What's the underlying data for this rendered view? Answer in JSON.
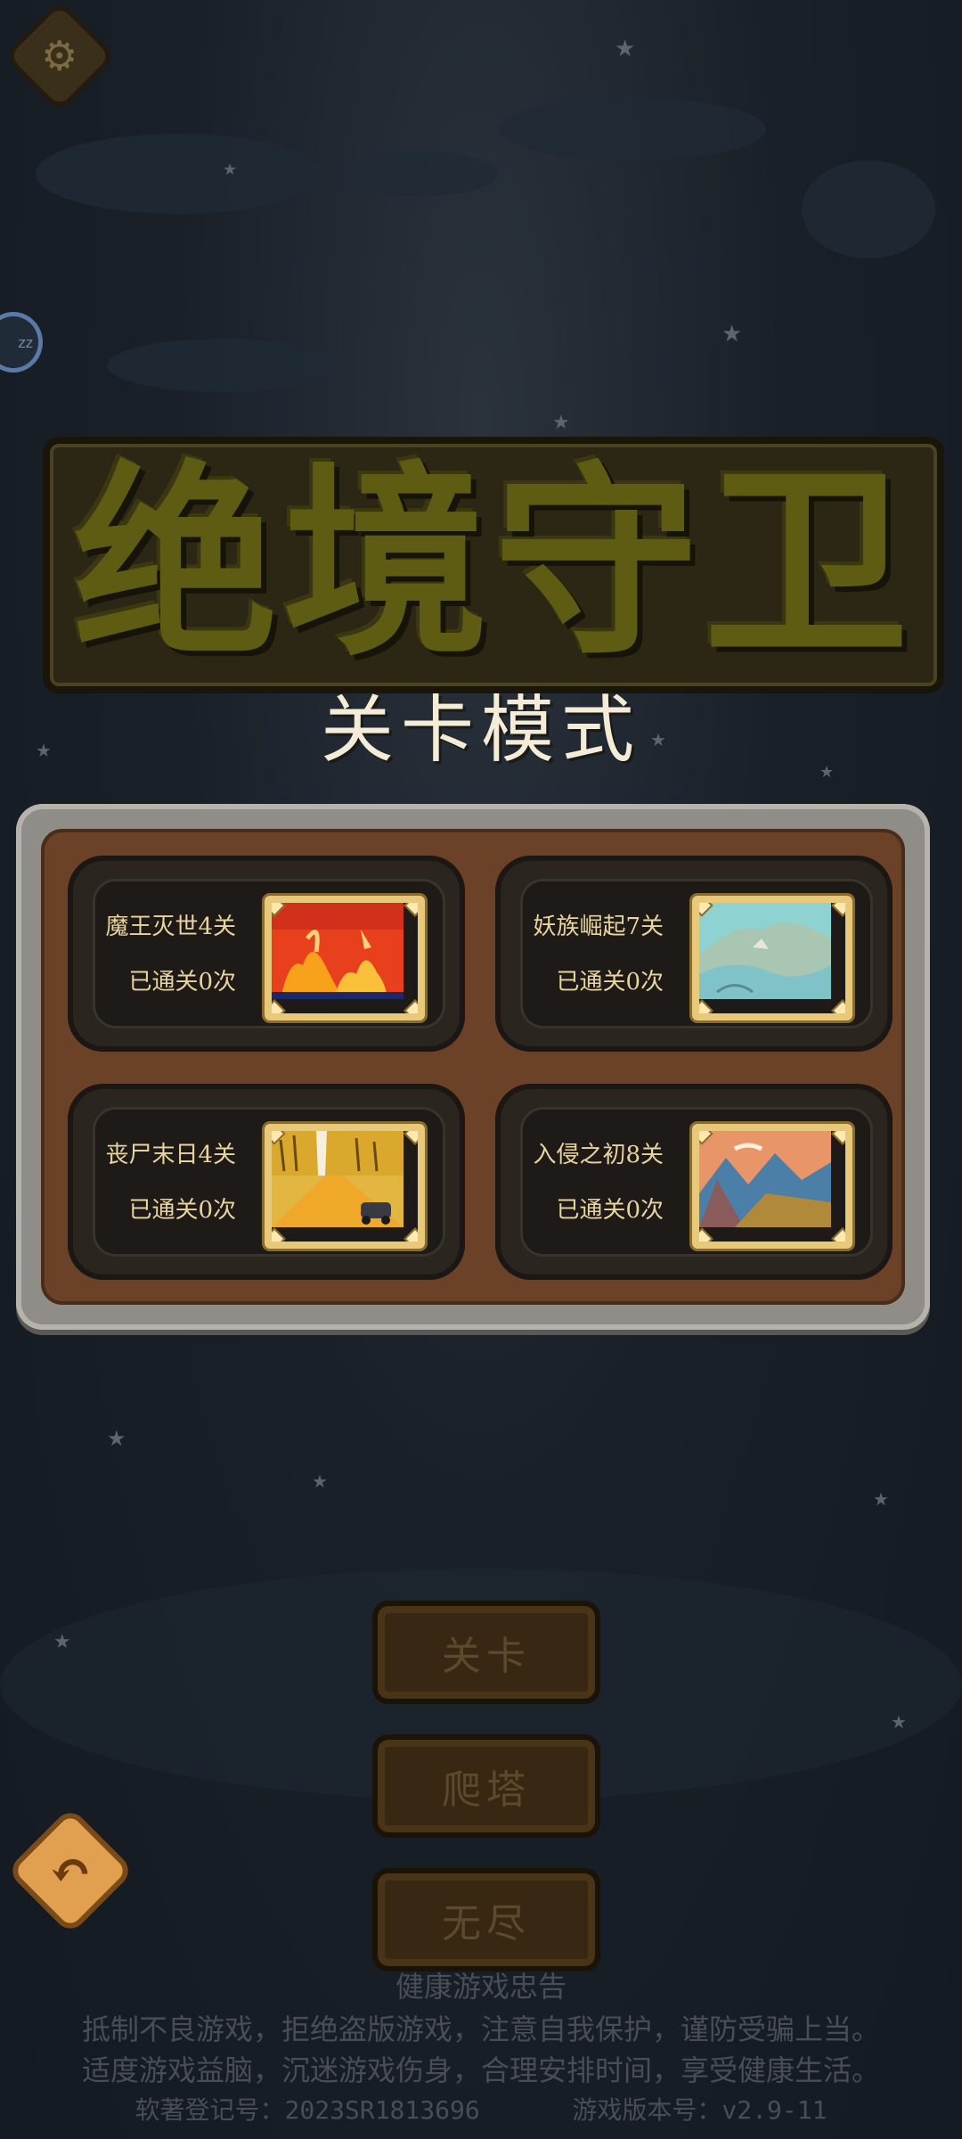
{
  "icons": {
    "settings": "gear-icon",
    "back": "undo-arrow-icon"
  },
  "side_badge": "zz",
  "title": "绝境守卫",
  "subtitle": "关卡模式",
  "levels": [
    {
      "name": "魔王灭世4关",
      "cleared": "已通关0次",
      "scene": "fire"
    },
    {
      "name": "妖族崛起7关",
      "cleared": "已通关0次",
      "scene": "mountain-water"
    },
    {
      "name": "丧尸末日4关",
      "cleared": "已通关0次",
      "scene": "desert-road"
    },
    {
      "name": "入侵之初8关",
      "cleared": "已通关0次",
      "scene": "sunset-mountains"
    }
  ],
  "modes": [
    "关卡",
    "爬塔",
    "无尽"
  ],
  "footer": {
    "heading": "健康游戏忠告",
    "line1": "抵制不良游戏，拒绝盗版游戏，注意自我保护，谨防受骗上当。",
    "line2": "适度游戏益脑，沉迷游戏伤身，合理安排时间，享受健康生活。",
    "copyright": "软著登记号：2023SR1813696",
    "version": "游戏版本号：v2.9-11"
  }
}
